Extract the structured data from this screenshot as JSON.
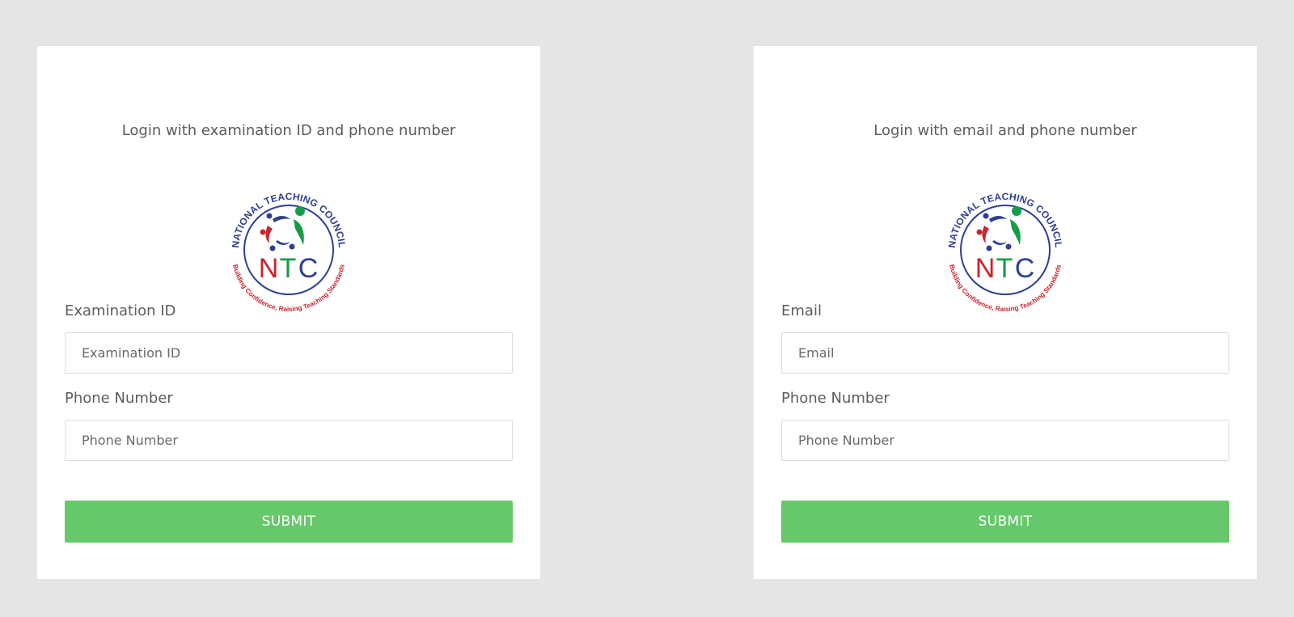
{
  "colors": {
    "page_background": "#e5e5e5",
    "card_background": "#ffffff",
    "submit_green": "#66c86a",
    "logo_blue": "#2e3f91",
    "logo_red": "#c8262e",
    "logo_green": "#179b48"
  },
  "logo": {
    "ring_top_text": "NATIONAL TEACHING COUNCIL",
    "ring_bottom_text": "Building Confidence, Raising Teaching Standards",
    "letters": [
      "N",
      "T",
      "C"
    ]
  },
  "forms": {
    "exam": {
      "title": "Login with examination ID and phone number",
      "field1_label": "Examination ID",
      "field1_placeholder": "Examination ID",
      "field2_label": "Phone Number",
      "field2_placeholder": "Phone Number",
      "submit_label": "SUBMIT"
    },
    "email": {
      "title": "Login with email and phone number",
      "field1_label": "Email",
      "field1_placeholder": "Email",
      "field2_label": "Phone Number",
      "field2_placeholder": "Phone Number",
      "submit_label": "SUBMIT"
    }
  }
}
